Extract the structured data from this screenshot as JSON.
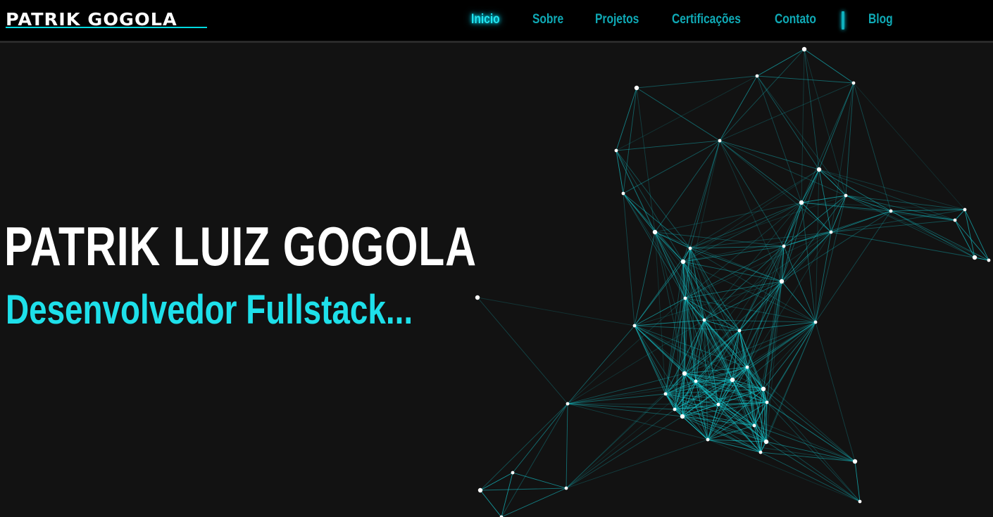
{
  "header": {
    "logo_text": "PATRIK GOGOLA",
    "nav": [
      {
        "label": "Inicio",
        "active": true
      },
      {
        "label": "Sobre",
        "active": false
      },
      {
        "label": "Projetos",
        "active": false
      },
      {
        "label": "Certificações",
        "active": false
      },
      {
        "label": "Contato",
        "active": false
      },
      {
        "label": "Blog",
        "active": false
      }
    ]
  },
  "hero": {
    "name": "PATRIK LUIZ GOGOLA",
    "role": "Desenvolvedor Fullstack..."
  },
  "colors": {
    "accent": "#1ee0ea",
    "background": "#121212",
    "navbar": "#000000",
    "network_line": "#14c8cf",
    "network_node": "#ffffff"
  }
}
